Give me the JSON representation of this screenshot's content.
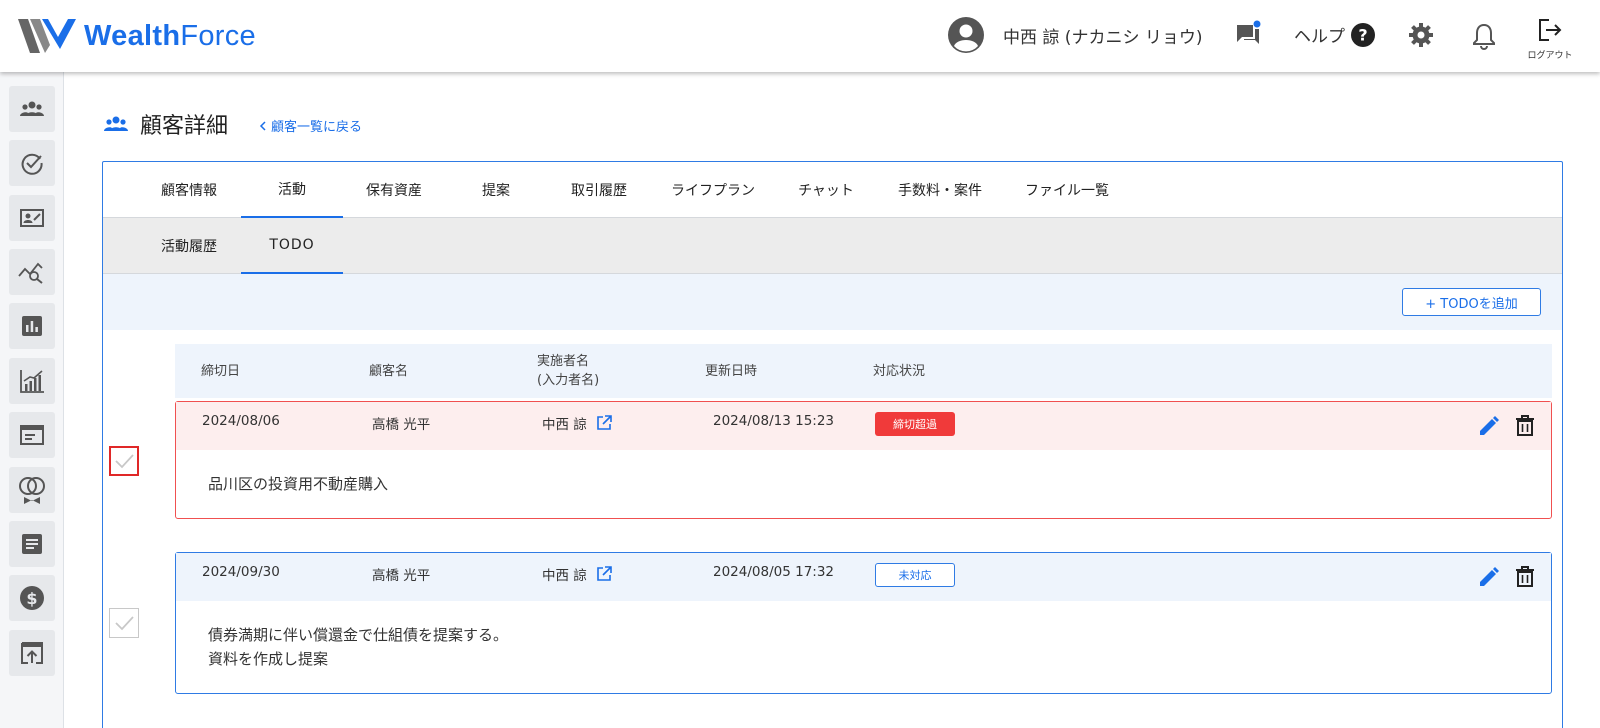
{
  "header": {
    "brand_bold": "Wealth",
    "brand_light": "Force",
    "user_name": "中西 諒 (ナカニシ リョウ)",
    "help_label": "ヘルプ",
    "logout_label": "ログアウト"
  },
  "page": {
    "title": "顧客詳細",
    "back_link": "顧客一覧に戻る"
  },
  "tabs": [
    "顧客情報",
    "活動",
    "保有資産",
    "提案",
    "取引履歴",
    "ライフプラン",
    "チャット",
    "手数料・案件",
    "ファイル一覧"
  ],
  "active_tab": "活動",
  "subtabs": [
    "活動履歴",
    "TODO"
  ],
  "active_subtab": "TODO",
  "toolbar": {
    "add_button": "+ TODOを追加"
  },
  "table": {
    "headers": {
      "deadline": "締切日",
      "customer": "顧客名",
      "assignee_line1": "実施者名",
      "assignee_line2": "(入力者名)",
      "updated": "更新日時",
      "status": "対応状況"
    },
    "rows": [
      {
        "deadline": "2024/08/06",
        "customer": "高橋 光平",
        "assignee": "中西 諒",
        "updated": "2024/08/13 15:23",
        "status": "締切超過",
        "body_line1": "品川区の投資用不動産購入",
        "body_line2": ""
      },
      {
        "deadline": "2024/09/30",
        "customer": "高橋 光平",
        "assignee": "中西 諒",
        "updated": "2024/08/05 17:32",
        "status": "未対応",
        "body_line1": "債券満期に伴い償還金で仕組債を提案する。",
        "body_line2": "資料を作成し提案"
      }
    ]
  },
  "colors": {
    "accent": "#1a6ee8",
    "overdue_red": "#f03a3a",
    "overdue_bg": "#fdeeee",
    "pending_bg": "#eef4fc"
  },
  "icons": {
    "sidebar": [
      "customers-icon",
      "check-circle-icon",
      "profile-card-icon",
      "search-chart-icon",
      "bar-chart-icon",
      "growth-chart-icon",
      "document-icon",
      "rings-icon",
      "notes-icon",
      "dollar-icon",
      "upload-icon"
    ]
  }
}
